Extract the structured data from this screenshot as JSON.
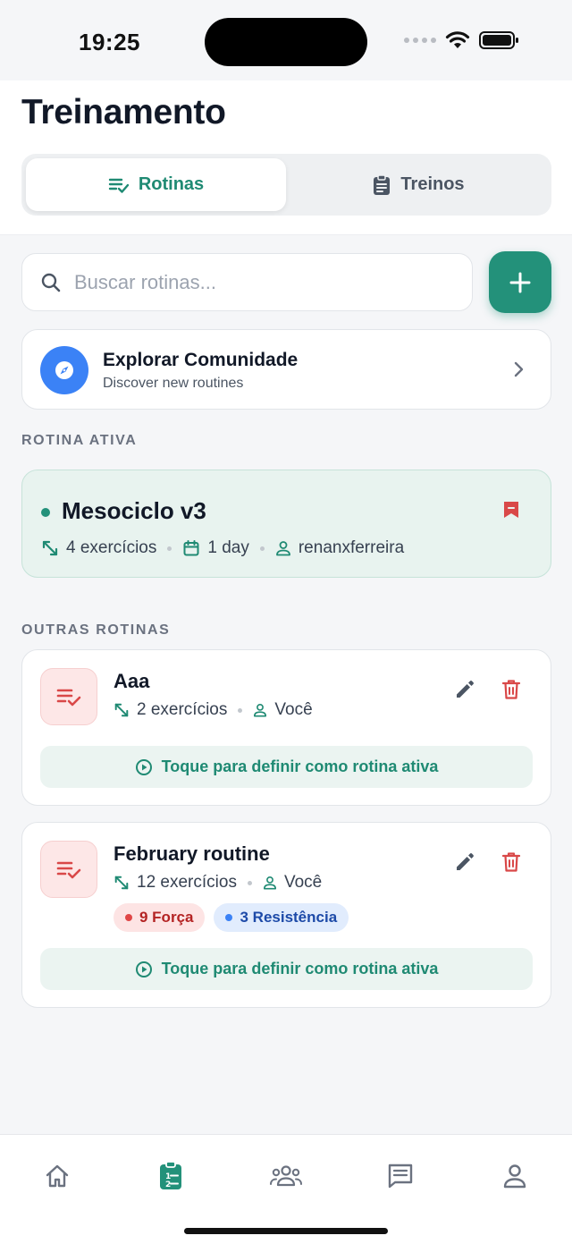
{
  "status_bar": {
    "time": "19:25"
  },
  "header": {
    "title": "Treinamento",
    "tabs": [
      {
        "label": "Rotinas",
        "icon": "playlist-check-icon",
        "selected": true
      },
      {
        "label": "Treinos",
        "icon": "clipboard-icon",
        "selected": false
      }
    ]
  },
  "search": {
    "placeholder": "Buscar rotinas...",
    "value": ""
  },
  "add_button": {
    "icon": "plus-icon"
  },
  "explore": {
    "title": "Explorar Comunidade",
    "subtitle": "Discover new routines",
    "icon": "compass-icon"
  },
  "active_section": {
    "label": "ROTINA ATIVA",
    "routine": {
      "name": "Mesociclo v3",
      "exercises": "4 exercícios",
      "days": "1 day",
      "author": "renanxferreira"
    }
  },
  "other_section": {
    "label": "OUTRAS ROTINAS",
    "routines": [
      {
        "name": "Aaa",
        "exercises": "2 exercícios",
        "author": "Você",
        "cta": "Toque para definir como rotina ativa"
      },
      {
        "name": "February routine",
        "exercises": "12 exercícios",
        "author": "Você",
        "tags": [
          {
            "label": "9 Força",
            "color": "#e04646"
          },
          {
            "label": "3 Resistência",
            "color": "#3b82f6"
          }
        ],
        "cta": "Toque para definir como rotina ativa"
      }
    ]
  },
  "tab_bar": {
    "items": [
      {
        "icon": "home-icon",
        "active": false
      },
      {
        "icon": "clipboard-list-icon",
        "active": true
      },
      {
        "icon": "group-icon",
        "active": false
      },
      {
        "icon": "chat-icon",
        "active": false
      },
      {
        "icon": "profile-icon",
        "active": false
      }
    ]
  },
  "colors": {
    "accent": "#23917a",
    "danger": "#d94848",
    "info": "#3b82f6"
  }
}
